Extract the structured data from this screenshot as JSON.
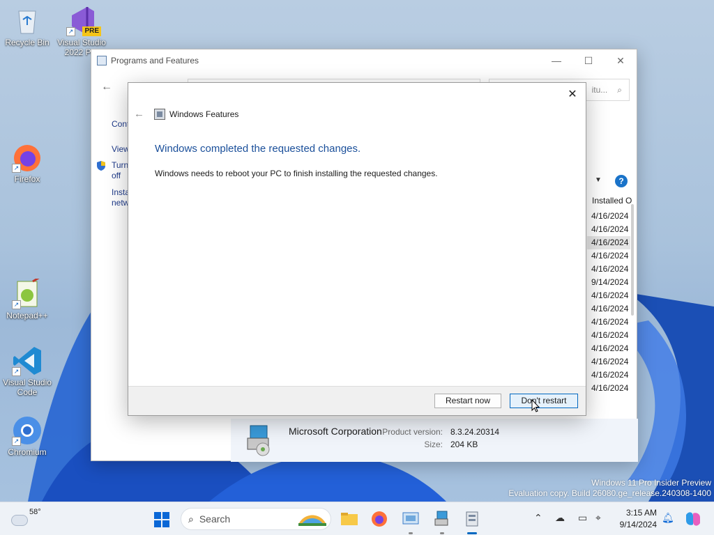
{
  "desktop": {
    "icons": [
      {
        "label": "Recycle Bin"
      },
      {
        "label": "Visual Studio 2022 Pre",
        "badge": "PRE"
      },
      {
        "label": "Firefox"
      },
      {
        "label": "Notepad++"
      },
      {
        "label": "Visual Studio Code"
      },
      {
        "label": "Chromium"
      }
    ]
  },
  "programs_window": {
    "title": "Programs and Features",
    "search_placeholder": "Search Progr...Featu...",
    "search_visible": "itu...",
    "sidebar": {
      "item1": "Cont",
      "item2": "View",
      "item3a": "Turn",
      "item3b": "off",
      "item4a": "Insta",
      "item4b": "netw"
    },
    "column_header": "Installed O",
    "dates": [
      "4/16/2024",
      "4/16/2024",
      "4/16/2024",
      "4/16/2024",
      "4/16/2024",
      "9/14/2024",
      "4/16/2024",
      "4/16/2024",
      "4/16/2024",
      "4/16/2024",
      "4/16/2024",
      "4/16/2024",
      "4/16/2024",
      "4/16/2024"
    ],
    "details": {
      "publisher": "Microsoft Corporation",
      "version_label": "Product version:",
      "version": "8.3.24.20314",
      "size_label": "Size:",
      "size": "204 KB"
    }
  },
  "features_dialog": {
    "title": "Windows Features",
    "heading": "Windows completed the requested changes.",
    "message": "Windows needs to reboot your PC to finish installing the requested changes.",
    "restart_label": "Restart now",
    "dont_restart_label": "Don't restart"
  },
  "watermark": {
    "line1": "Windows 11 Pro Insider Preview",
    "line2": "Evaluation copy. Build 26080.ge_release.240308-1400"
  },
  "taskbar": {
    "temperature": "58°",
    "search_label": "Search",
    "time": "3:15 AM",
    "date": "9/14/2024",
    "accent": "#0067c0"
  }
}
